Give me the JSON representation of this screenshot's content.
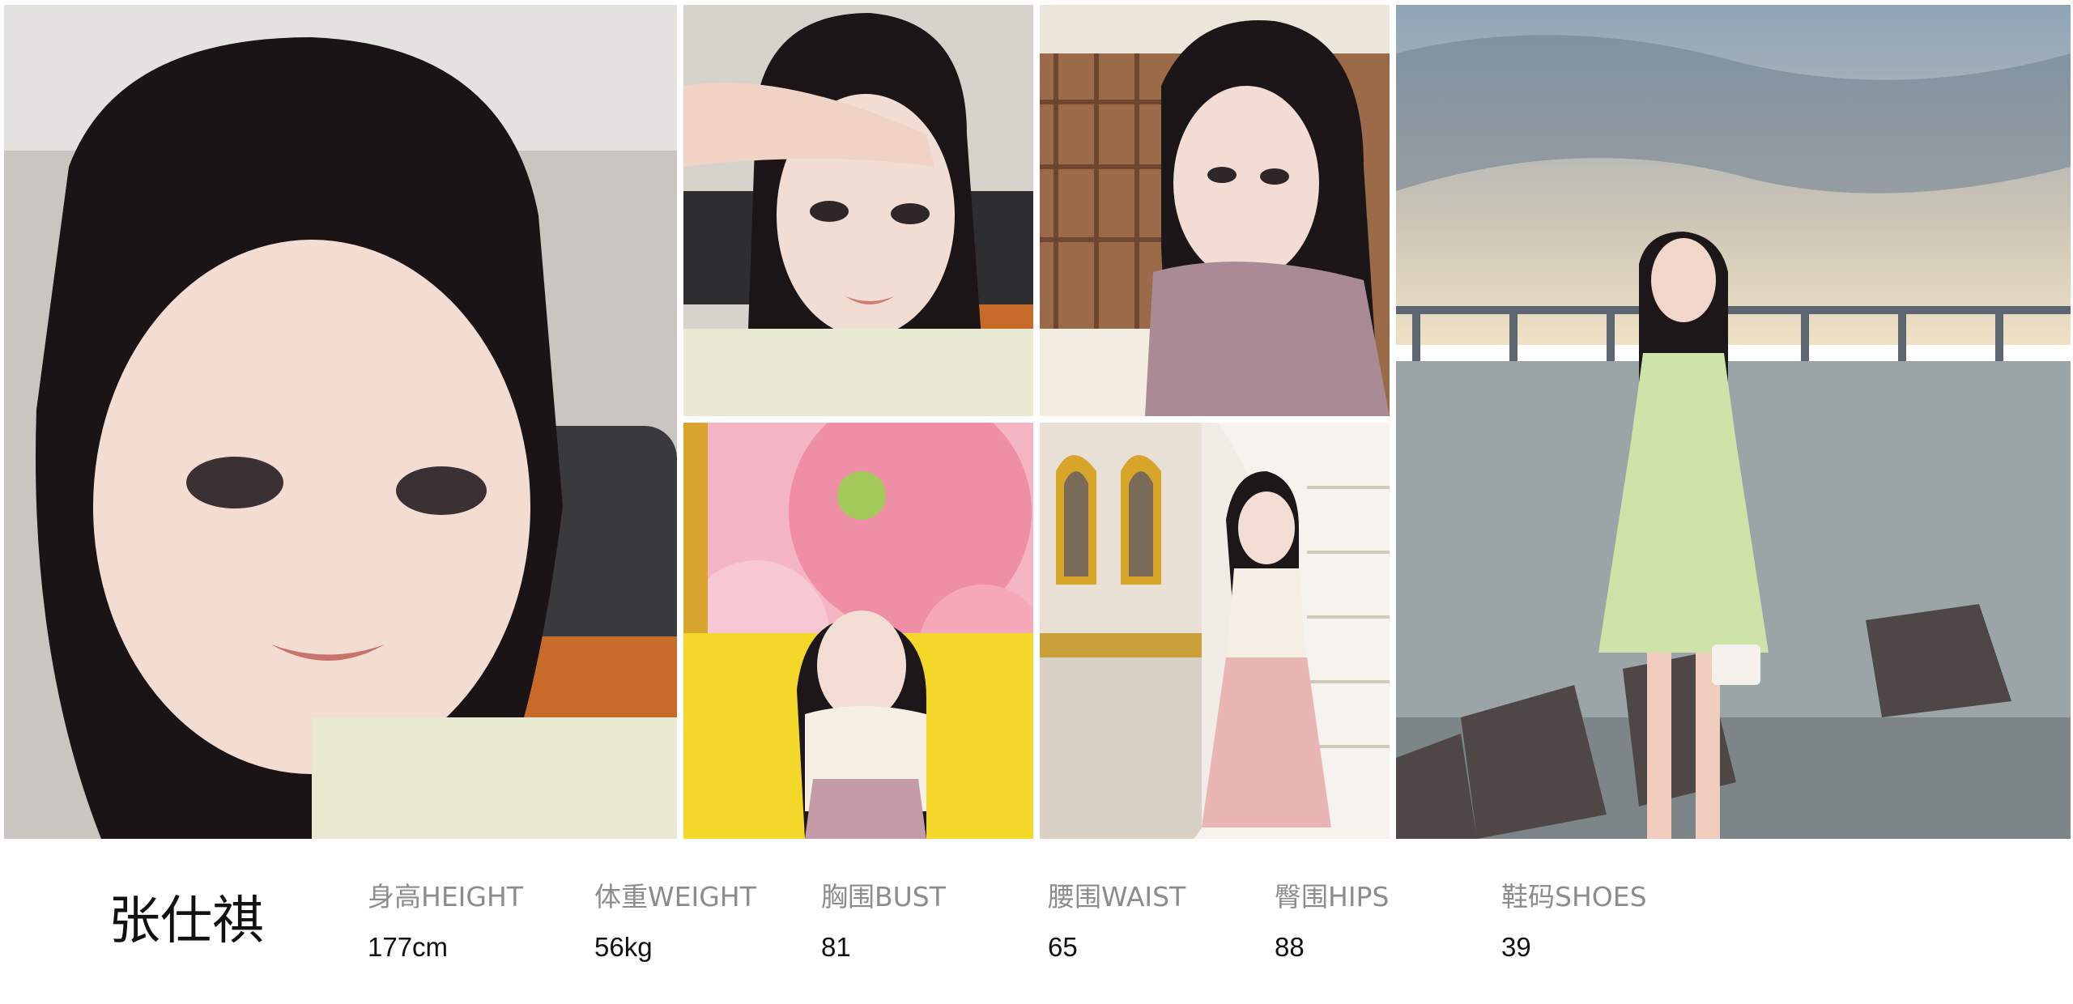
{
  "model": {
    "name": "张仕祺"
  },
  "stats": [
    {
      "label": "身高HEIGHT",
      "value": "177cm"
    },
    {
      "label": "体重WEIGHT",
      "value": "56kg"
    },
    {
      "label": "胸围BUST",
      "value": "81"
    },
    {
      "label": "腰围WAIST",
      "value": "65"
    },
    {
      "label": "臀围HIPS",
      "value": "88"
    },
    {
      "label": "鞋码SHOES",
      "value": "39"
    }
  ],
  "colors": {
    "background": "#ffffff",
    "name_text": "#111111",
    "label_text": "#8c8c8c",
    "value_text": "#111111"
  }
}
